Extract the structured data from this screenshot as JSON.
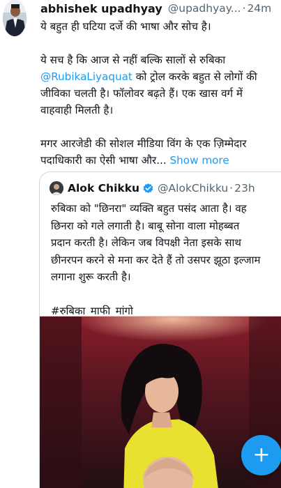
{
  "tweet": {
    "author_name": "abhishek upadhyay",
    "author_handle": "@upadhyay...",
    "separator": "·",
    "time": "24m",
    "line1": "ये बहुत ही घटिया दर्जे की भाषा और सोच है।",
    "para2_line1": "ये सच है कि आज से नहीं बल्कि सालों से रुबिका",
    "mention": "@RubikaLiyaquat",
    "para2_line2_rest": " को ट्रोल करके बहुत से लोगों की",
    "para2_line3": "जीविका चलती है। फॉलोवर बढ़ते हैं। एक खास वर्ग में",
    "para2_line4": "वाहवाही मिलती है।",
    "para3_line1": "मगर आरजेडी की सोशल मीडिया विंग के एक ज़िम्मेदार",
    "para3_line2": "पदाधिकारी का ऐसी भाषा और...",
    "show_more": "Show more"
  },
  "quote": {
    "author_name": "Alok Chikku",
    "author_handle": "@AlokChikku",
    "separator": "·",
    "time": "23h",
    "line1": "रुबिका को \"छिनरा\" व्यक्ति बहुत पसंद आता है। वह",
    "line2": "छिनरा को गले लगाती है। बाबू सोना वाला मोहब्बत",
    "line3": "प्रदान करती है। लेकिन जब विपक्षी नेता इसके साथ",
    "line4": "छीनरपन करने से मना कर देते हैं तो उसपर झूठा इल्जाम",
    "line5": "लगाना शुरू करती है।",
    "hashtag": "#रुबिका_माफी_मांगो",
    "media_icon": "photo"
  },
  "fab": {
    "label": "+",
    "icon": "compose-plus-icon"
  },
  "colors": {
    "link": "#1d9bf0",
    "secondary": "#536471",
    "border": "#cfd9de",
    "fab": "#1d9bf0"
  }
}
